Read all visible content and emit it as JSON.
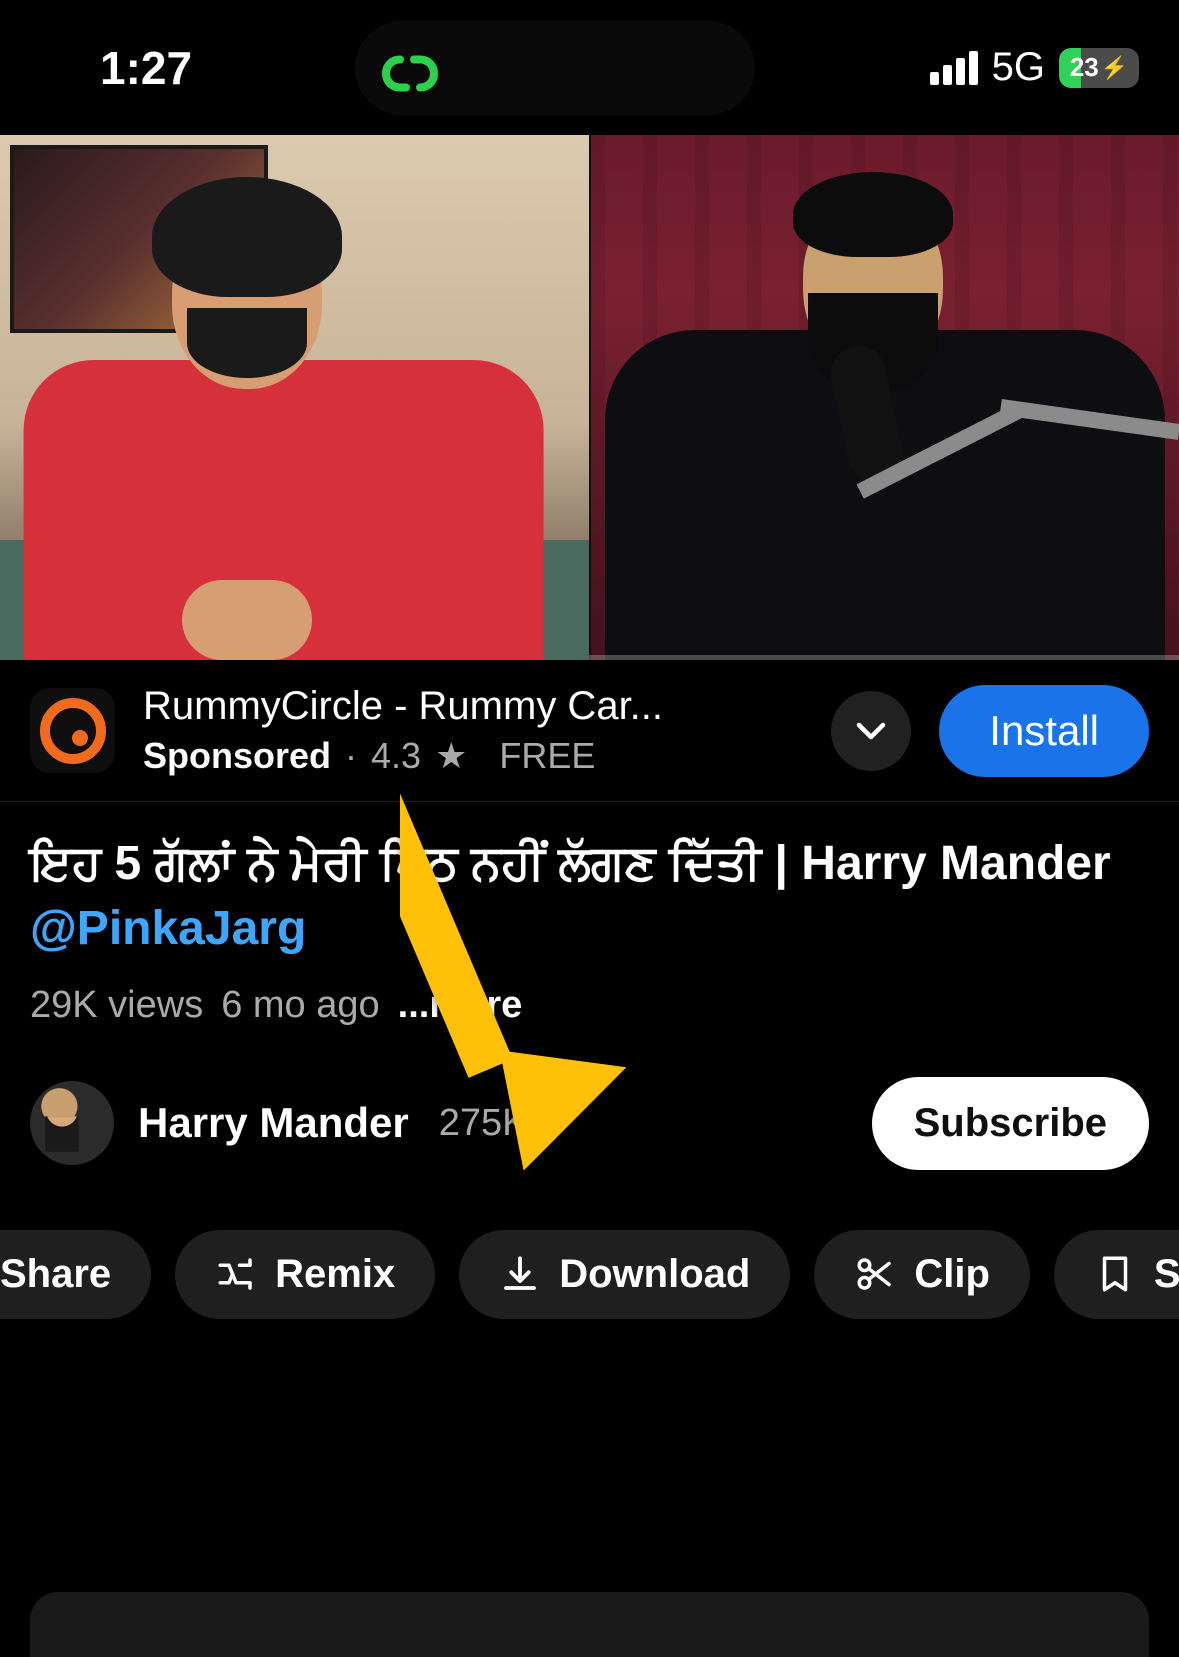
{
  "statusBar": {
    "time": "1:27",
    "network": "5G",
    "batteryPercent": "23",
    "batteryWidthPct": "28%"
  },
  "ad": {
    "title": "RummyCircle - Rummy Car...",
    "sponsoredLabel": "Sponsored",
    "rating": "4.3",
    "priceLabel": "FREE",
    "installLabel": "Install"
  },
  "video": {
    "titlePrefix": "ਇਹ 5 ਗੱਲਾਂ ਨੇ ਮੇਰੀ ਪਿੱਠ ਨਹੀਂ ਲੱਗਣ ਦਿੱਤੀ | Harry Mander ",
    "mention": "@PinkaJarg",
    "views": "29K views",
    "age": "6 mo ago",
    "moreLabel": "...more"
  },
  "channel": {
    "name": "Harry Mander",
    "subs": "275K",
    "subscribeLabel": "Subscribe"
  },
  "actions": {
    "share": "Share",
    "remix": "Remix",
    "download": "Download",
    "clip": "Clip",
    "save": "Save"
  }
}
